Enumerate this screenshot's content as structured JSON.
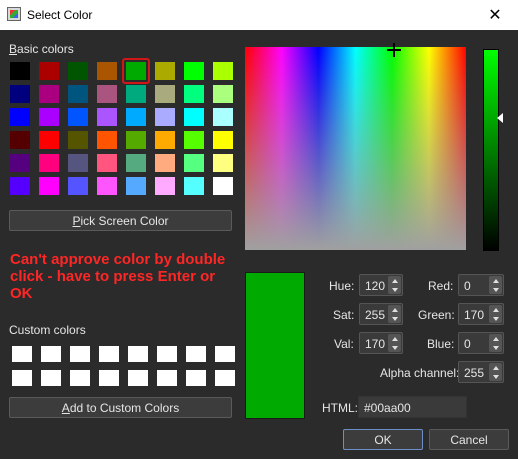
{
  "window": {
    "title": "Select Color",
    "close_glyph": "✕"
  },
  "basic_colors": {
    "label": "Basic colors",
    "swatches": [
      "#000000",
      "#aa0000",
      "#005500",
      "#aa5500",
      "#00aa00",
      "#aaaa00",
      "#00ff00",
      "#aaff00",
      "#00007f",
      "#aa007f",
      "#00557f",
      "#aa557f",
      "#00aa7f",
      "#aaaa7f",
      "#00ff7f",
      "#aaff7f",
      "#0000ff",
      "#aa00ff",
      "#0055ff",
      "#aa55ff",
      "#00aaff",
      "#aaaaff",
      "#00ffff",
      "#aaffff",
      "#550000",
      "#ff0000",
      "#555500",
      "#ff5500",
      "#55aa00",
      "#ffaa00",
      "#55ff00",
      "#ffff00",
      "#55007f",
      "#ff007f",
      "#55557f",
      "#ff557f",
      "#55aa7f",
      "#ffaa7f",
      "#55ff7f",
      "#ffff7f",
      "#5500ff",
      "#ff00ff",
      "#5555ff",
      "#ff55ff",
      "#55aaff",
      "#ffaaff",
      "#55ffff",
      "#ffffff"
    ],
    "selected_index": 4
  },
  "pick_screen_label": "Pick Screen Color",
  "annotation": "Can't approve color by double click - have to press Enter or OK",
  "custom_colors": {
    "label": "Custom colors",
    "swatches": [
      "#ffffff",
      "#ffffff",
      "#ffffff",
      "#ffffff",
      "#ffffff",
      "#ffffff",
      "#ffffff",
      "#ffffff",
      "#ffffff",
      "#ffffff",
      "#ffffff",
      "#ffffff",
      "#ffffff",
      "#ffffff",
      "#ffffff",
      "#ffffff"
    ]
  },
  "add_custom_label": "Add to Custom Colors",
  "current_color": "#00aa00",
  "fields": {
    "hue": {
      "label": "Hue:",
      "value": "120"
    },
    "sat": {
      "label": "Sat:",
      "value": "255"
    },
    "val": {
      "label": "Val:",
      "value": "170"
    },
    "red": {
      "label": "Red:",
      "value": "0"
    },
    "green": {
      "label": "Green:",
      "value": "170"
    },
    "blue": {
      "label": "Blue:",
      "value": "0"
    },
    "alpha": {
      "label": "Alpha channel:",
      "value": "255"
    },
    "html": {
      "label": "HTML:",
      "value": "#00aa00"
    }
  },
  "buttons": {
    "ok": "OK",
    "cancel": "Cancel"
  }
}
